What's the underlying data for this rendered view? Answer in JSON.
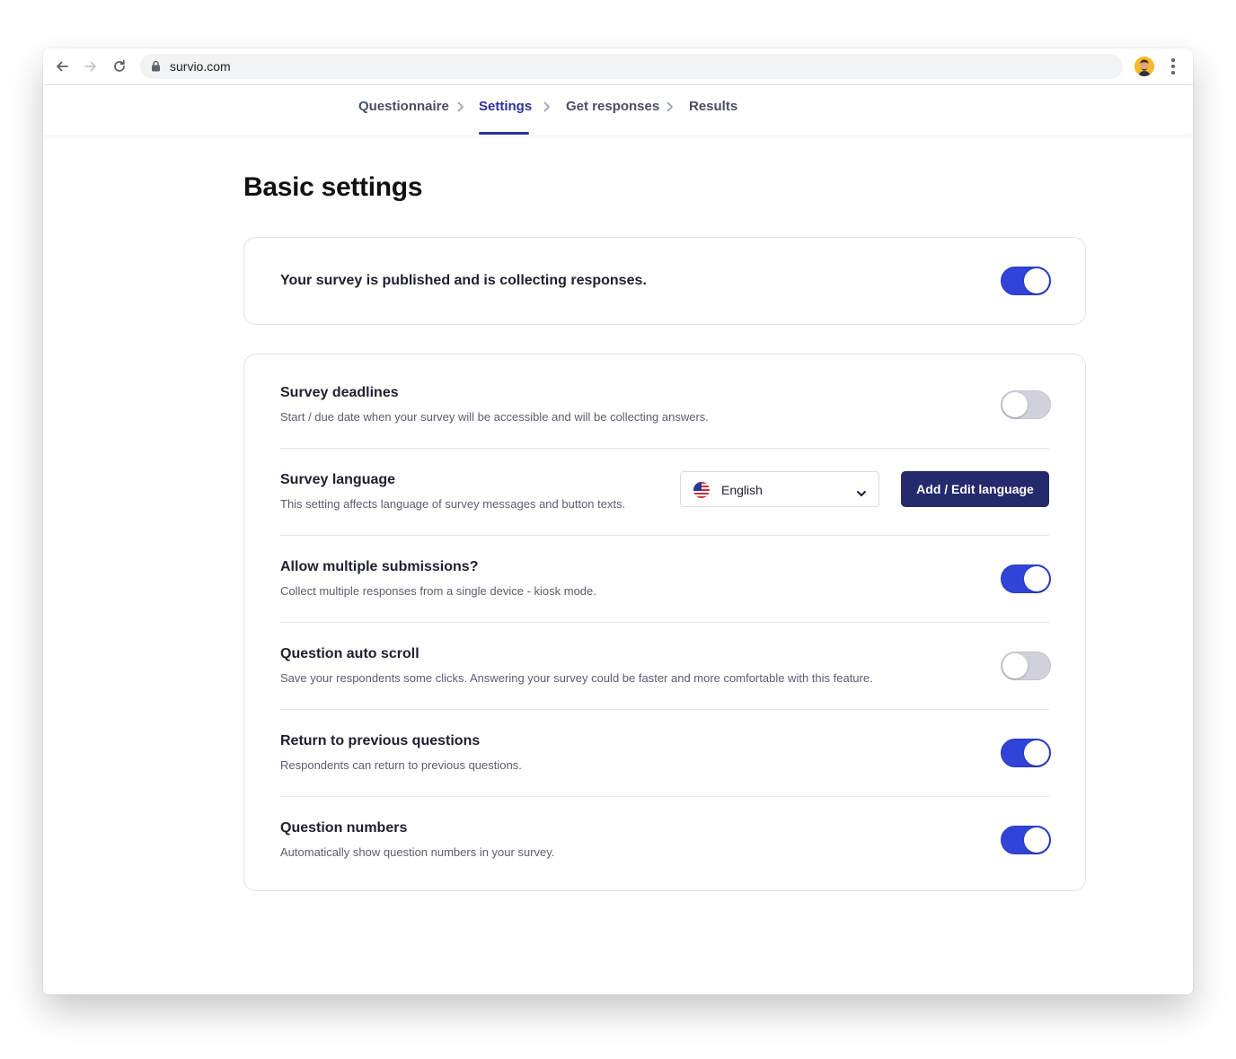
{
  "browser": {
    "url": "survio.com",
    "icons": [
      "back-arrow-icon",
      "forward-arrow-icon",
      "reload-icon",
      "lock-icon",
      "avatar",
      "more-vert-icon"
    ]
  },
  "nav": {
    "steps": [
      {
        "label": "Questionnaire",
        "active": false
      },
      {
        "label": "Settings",
        "active": true
      },
      {
        "label": "Get responses",
        "active": false
      },
      {
        "label": "Results",
        "active": false
      }
    ]
  },
  "page": {
    "title": "Basic settings"
  },
  "publish": {
    "text": "Your survey is published and is collecting responses.",
    "enabled": true
  },
  "settings": [
    {
      "title": "Survey deadlines",
      "desc": "Start / due date when your survey will be accessible and will be collecting answers.",
      "enabled": false
    },
    {
      "title": "Survey language",
      "desc": "This setting affects language of survey messages and button texts."
    },
    {
      "title": "Allow multiple submissions?",
      "desc": "Collect multiple responses from a single device - kiosk mode.",
      "enabled": true
    },
    {
      "title": "Question auto scroll",
      "desc": "Save your respondents some clicks. Answering your survey could be faster and more comfortable with this feature.",
      "enabled": false
    },
    {
      "title": "Return to previous questions",
      "desc": "Respondents can return to previous questions.",
      "enabled": true
    },
    {
      "title": "Question numbers",
      "desc": "Automatically show question numbers in your survey.",
      "enabled": true
    }
  ],
  "language": {
    "selected": "English",
    "flag_icon": "us-flag-icon",
    "button_label": "Add / Edit language"
  },
  "colors": {
    "accent": "#3044d9",
    "nav_active": "#2d2f9e",
    "button": "#242a6b"
  }
}
